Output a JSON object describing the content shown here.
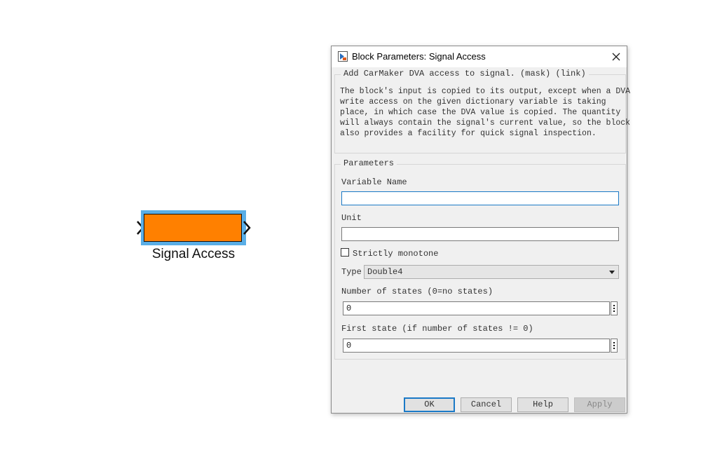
{
  "canvas": {
    "block": {
      "label": "Signal Access",
      "fill_color": "#ff8000",
      "selection_color": "#5aaee6"
    }
  },
  "dialog": {
    "title": "Block Parameters: Signal Access",
    "description_group": {
      "title": "Add CarMaker DVA access to signal. (mask) (link)",
      "lines": [
        "The block's input is copied to its output, except when a DVA",
        "write access on the given dictionary variable is taking",
        "place, in which case the DVA value is copied. The quantity",
        "will always contain the signal's current value, so the block",
        "also provides a facility for quick signal inspection."
      ]
    },
    "parameters_group": {
      "title": "Parameters",
      "variable_name": {
        "label": "Variable Name",
        "value": ""
      },
      "unit": {
        "label": "Unit",
        "value": ""
      },
      "strictly_monotone": {
        "label": "Strictly monotone",
        "checked": false
      },
      "type": {
        "label": "Type",
        "selected": "Double4"
      },
      "number_of_states": {
        "label": "Number of states (0=no states)",
        "value": "0"
      },
      "first_state": {
        "label": "First state (if number of states != 0)",
        "value": "0"
      }
    },
    "buttons": {
      "ok": "OK",
      "cancel": "Cancel",
      "help": "Help",
      "apply": "Apply"
    },
    "accent_color": "#1a79c6"
  }
}
